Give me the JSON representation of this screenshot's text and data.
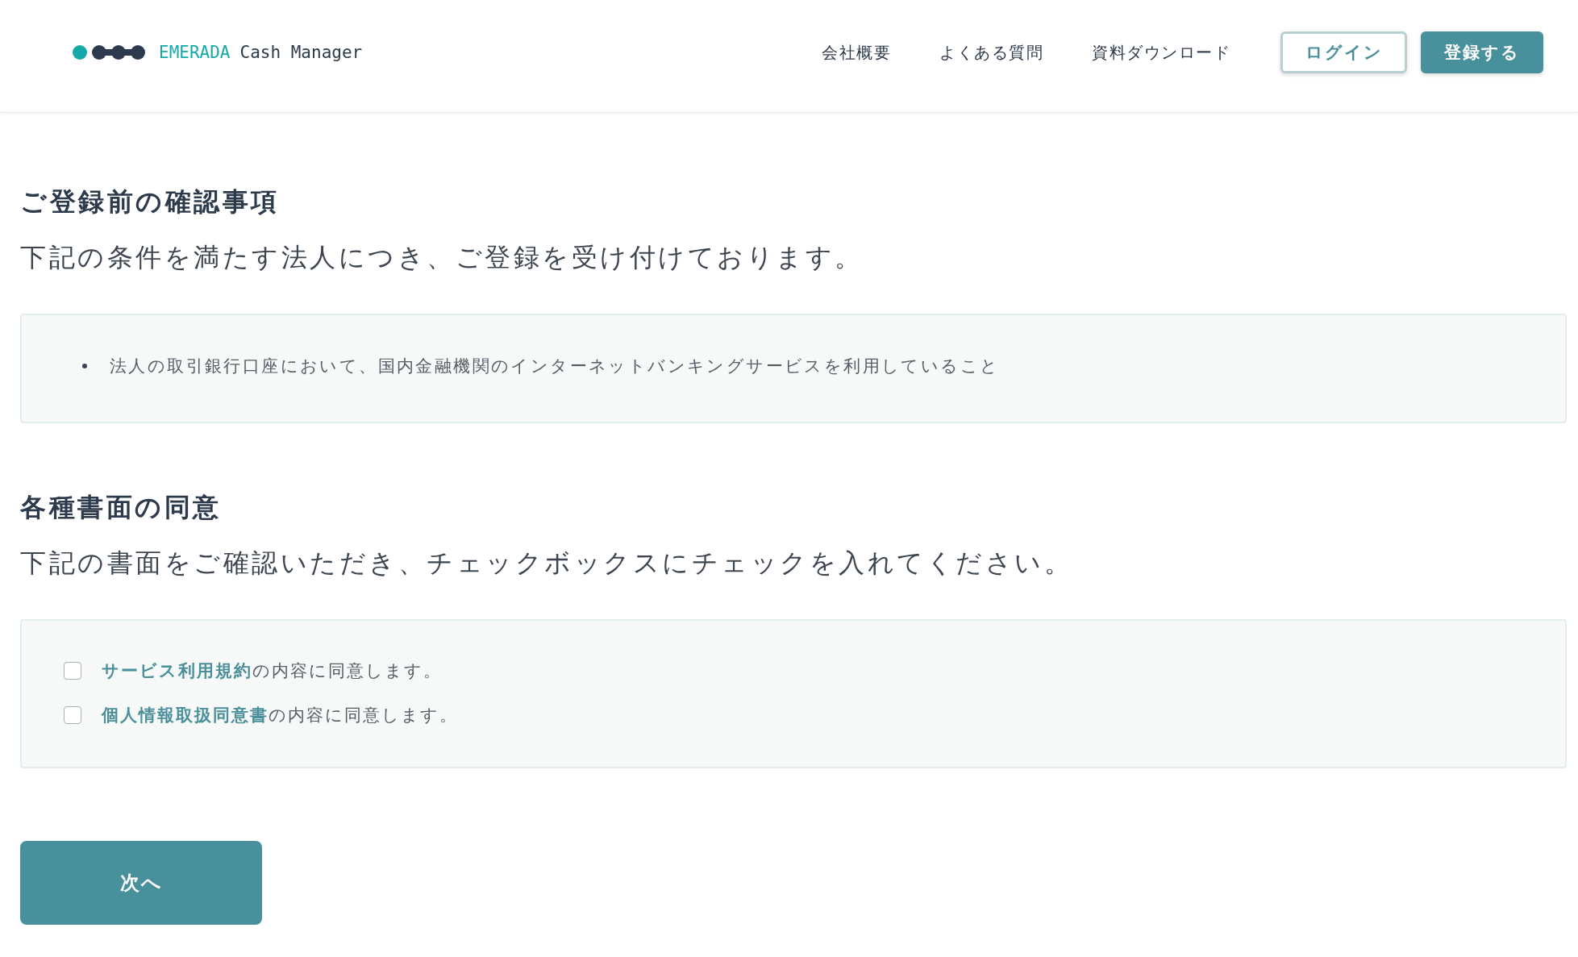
{
  "header": {
    "logo": {
      "brand": "EMERADA",
      "product": "Cash Manager"
    },
    "nav": [
      {
        "label": "会社概要"
      },
      {
        "label": "よくある質問"
      },
      {
        "label": "資料ダウンロード"
      }
    ],
    "buttons": [
      {
        "label": "ログイン",
        "kind": "outline"
      },
      {
        "label": "登録する",
        "kind": "filled"
      }
    ]
  },
  "sections": [
    {
      "kind": "list",
      "heading": "ご登録前の確認事項",
      "lead": "下記の条件を満たす法人につき、ご登録を受け付けております。",
      "items": [
        "法人の取引銀行口座において、国内金融機関のインターネットバンキングサービスを利用していること"
      ]
    },
    {
      "kind": "agreements",
      "heading": "各種書面の同意",
      "lead": "下記の書面をご確認いただき、チェックボックスにチェックを入れてください。",
      "agreements": [
        {
          "link": "サービス利用規約",
          "text": "の内容に同意します。",
          "checked": false
        },
        {
          "link": "個人情報取扱同意書",
          "text": "の内容に同意します。",
          "checked": false
        }
      ]
    }
  ],
  "next_button": {
    "label": "次へ"
  }
}
